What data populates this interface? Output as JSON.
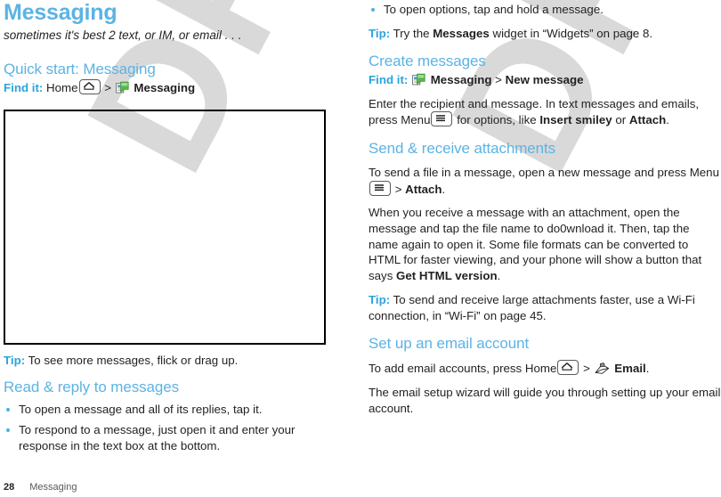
{
  "document": {
    "watermark_text": "DRAFT",
    "watermark_color": "#d9d9d9",
    "accent_color": "#5cb3e4",
    "link_color": "#2aa3dd",
    "text_color": "#231f20"
  },
  "chapter": {
    "title": "Messaging",
    "subtitle": "sometimes it's best 2 text, or IM, or email . . ."
  },
  "left_column": {
    "quick_start": {
      "heading": "Quick start: Messaging",
      "find_it_label": "Find it:",
      "find_it_part1": "Home",
      "home_icon": "home-key-icon",
      "separator": ">",
      "messaging_icon": "messaging-app-icon",
      "find_it_part2": "Messaging"
    },
    "screenshot_placeholder": {
      "alt": "messaging conversation list screenshot"
    },
    "tip_flick": {
      "label": "Tip:",
      "text": "To see more messages, flick or drag up."
    },
    "read_reply": {
      "heading": "Read & reply to messages",
      "bullets": [
        "To open a message and all of its replies, tap it.",
        "To respond to a message, just open it and enter your response in the text box at the bottom."
      ]
    }
  },
  "right_column": {
    "bullets_continued": [
      "To open options, tap and hold a message."
    ],
    "tip_widget": {
      "label": "Tip:",
      "text_before": "Try the",
      "bold": "Messages",
      "text_after": "widget in “Widgets” on page 8."
    },
    "create_messages": {
      "heading": "Create messages",
      "find_it_label": "Find it:",
      "messaging_icon": "messaging-app-icon",
      "find_it_app": "Messaging",
      "separator": ">",
      "find_it_action": "New message",
      "body_1a": "Enter the recipient and message. In text messages and emails, press Menu",
      "menu_icon": "menu-key-icon",
      "body_1b": "for options, like",
      "bold_1": "Insert smiley",
      "body_1c": "or",
      "bold_2": "Attach",
      "body_1d": "."
    },
    "attachments": {
      "heading": "Send & receive attachments",
      "body_1a": "To send a file in a message, open a new message and press Menu",
      "menu_icon": "menu-key-icon",
      "body_1b": ">",
      "bold_1": "Attach",
      "body_1c": ".",
      "body_2a": "When you receive a message with an attachment, open the message and tap the file name to do0wnload it. Then, tap the name again to open it. Some file formats can be converted to HTML for faster viewing, and your phone will show a button that says",
      "bold_2": "Get HTML version",
      "body_2b": ".",
      "tip_label": "Tip:",
      "tip_text": "To send and receive large attachments faster, use a Wi-Fi connection, in “Wi-Fi” on page 45."
    },
    "email_account": {
      "heading": "Set up an email account",
      "body_1a": "To add email accounts, press Home",
      "home_icon": "home-key-icon",
      "separator": ">",
      "email_icon": "email-app-icon",
      "bold_1": "Email",
      "body_1b": ".",
      "body_2": "The email setup wizard will guide you through setting up your email account."
    }
  },
  "footer": {
    "page_number": "28",
    "section": "Messaging"
  }
}
